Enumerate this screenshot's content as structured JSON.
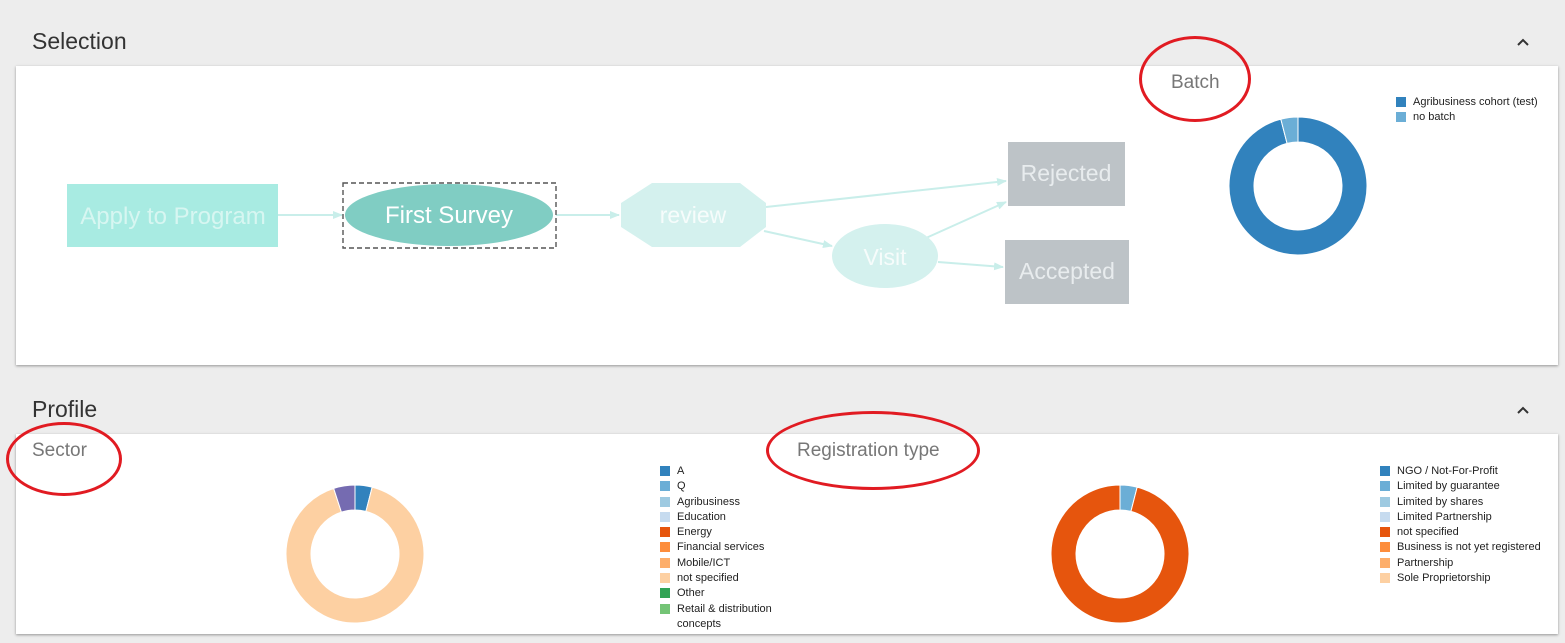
{
  "selection": {
    "title": "Selection",
    "workflow": {
      "nodes": {
        "apply": "Apply to Program",
        "first_survey": "First Survey",
        "review": "review",
        "visit": "Visit",
        "rejected": "Rejected",
        "accepted": "Accepted"
      }
    },
    "batch_chart": {
      "title": "Batch",
      "legend": [
        {
          "label": "Agribusiness cohort (test)",
          "color": "#3182bd"
        },
        {
          "label": "no batch",
          "color": "#6baed6"
        }
      ]
    }
  },
  "profile": {
    "title": "Profile",
    "sector_chart": {
      "title": "Sector",
      "legend": [
        {
          "label": "A",
          "color": "#3182bd"
        },
        {
          "label": "Q",
          "color": "#6baed6"
        },
        {
          "label": "Agribusiness",
          "color": "#9ecae1"
        },
        {
          "label": "Education",
          "color": "#c6dbef"
        },
        {
          "label": "Energy",
          "color": "#e6550d"
        },
        {
          "label": "Financial services",
          "color": "#fd8d3c"
        },
        {
          "label": "Mobile/ICT",
          "color": "#fdae6b"
        },
        {
          "label": "not specified",
          "color": "#fdd0a2"
        },
        {
          "label": "Other",
          "color": "#31a354"
        },
        {
          "label": "Retail & distribution",
          "label2": "concepts",
          "color": "#74c476"
        }
      ]
    },
    "registration_chart": {
      "title": "Registration type",
      "legend": [
        {
          "label": "NGO / Not-For-Profit",
          "color": "#3182bd"
        },
        {
          "label": "Limited by guarantee",
          "color": "#6baed6"
        },
        {
          "label": "Limited by shares",
          "color": "#9ecae1"
        },
        {
          "label": "Limited Partnership",
          "color": "#c6dbef"
        },
        {
          "label": "not specified",
          "color": "#e6550d"
        },
        {
          "label": "Business is not yet registered",
          "color": "#fd8d3c"
        },
        {
          "label": "Partnership",
          "color": "#fdae6b"
        },
        {
          "label": "Sole Proprietorship",
          "color": "#fdd0a2"
        }
      ]
    }
  },
  "chart_data": [
    {
      "type": "pie",
      "title": "Batch",
      "categories": [
        "Agribusiness cohort (test)",
        "no batch"
      ],
      "values": [
        96,
        4
      ],
      "colors": [
        "#3182bd",
        "#6baed6"
      ]
    },
    {
      "type": "pie",
      "title": "Sector",
      "categories": [
        "A",
        "not specified",
        "Other-purple"
      ],
      "values": [
        4,
        91,
        5
      ],
      "colors": [
        "#3182bd",
        "#fdd0a2",
        "#756bb1"
      ]
    },
    {
      "type": "pie",
      "title": "Registration type",
      "categories": [
        "Limited by guarantee",
        "not specified"
      ],
      "values": [
        4,
        96
      ],
      "colors": [
        "#6baed6",
        "#e6550d"
      ]
    }
  ]
}
